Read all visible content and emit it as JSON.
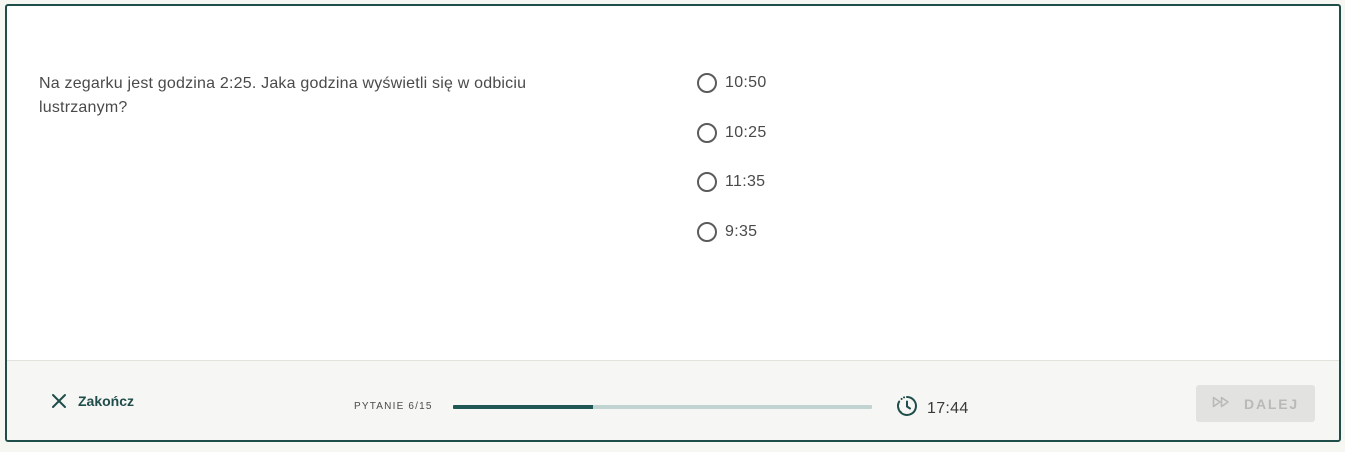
{
  "question": {
    "text": "Na zegarku jest godzina 2:25. Jaka godzina wyświetli się w odbiciu lustrzanym?"
  },
  "answers": [
    {
      "label": "10:50"
    },
    {
      "label": "10:25"
    },
    {
      "label": "11:35"
    },
    {
      "label": "9:35"
    }
  ],
  "footer": {
    "quit_label": "Zakończ",
    "quit_icon": "close-icon",
    "progress_text": "PYTANIE 6/15",
    "progress_value": 0.333,
    "timer_icon": "timer-icon",
    "timer_value": "17:44",
    "next_icon": "fast-forward-icon",
    "next_label": "DALEJ",
    "next_disabled": true
  },
  "colors": {
    "accent": "#1f4d4a",
    "progress_fill": "#1f5754",
    "progress_track": "#c2d4d2",
    "disabled_button_bg": "#e2e2e0",
    "disabled_button_text": "#b9b9b7"
  }
}
